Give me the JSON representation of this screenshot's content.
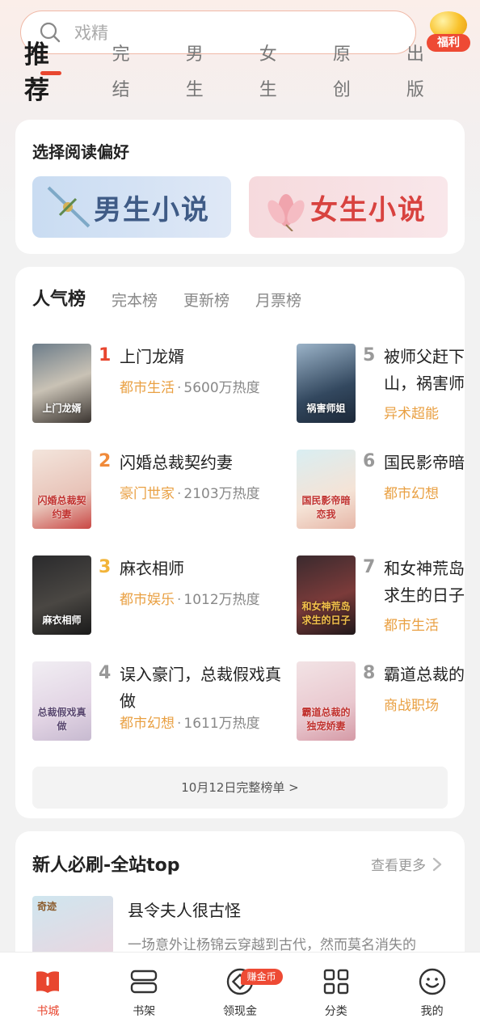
{
  "search": {
    "placeholder": "戏精"
  },
  "welfare": {
    "label": "福利"
  },
  "tabs": [
    {
      "label": "推荐",
      "active": true
    },
    {
      "label": "完结"
    },
    {
      "label": "男生"
    },
    {
      "label": "女生"
    },
    {
      "label": "原创"
    },
    {
      "label": "出版"
    }
  ],
  "preference": {
    "title": "选择阅读偏好",
    "male_label": "男生小说",
    "female_label": "女生小说"
  },
  "ranking": {
    "tabs": [
      "人气榜",
      "完本榜",
      "更新榜",
      "月票榜"
    ],
    "books": [
      {
        "rank": "1",
        "name": "上门龙婿",
        "category": "都市生活",
        "heat": "5600万热度",
        "cover_text": "上门龙婿",
        "rank_color": "#e8462f"
      },
      {
        "rank": "2",
        "name": "闪婚总裁契约妻",
        "category": "豪门世家",
        "heat": "2103万热度",
        "cover_text": "闪婚总裁契约妻",
        "rank_color": "#f08a3a"
      },
      {
        "rank": "3",
        "name": "麻衣相师",
        "category": "都市娱乐",
        "heat": "1012万热度",
        "cover_text": "麻衣相师",
        "rank_color": "#f2b43a"
      },
      {
        "rank": "4",
        "name": "误入豪门，总裁假戏真做",
        "category": "都市幻想",
        "heat": "1611万热度",
        "cover_text": "总裁假戏真做",
        "rank_color": "#999999"
      },
      {
        "rank": "5",
        "name": "被师父赶下山，祸害师姐",
        "category": "异术超能",
        "heat": "",
        "cover_text": "祸害师姐",
        "rank_color": "#999999"
      },
      {
        "rank": "6",
        "name": "国民影帝暗恋我",
        "category": "都市幻想",
        "heat": "",
        "cover_text": "国民影帝暗恋我",
        "rank_color": "#999999"
      },
      {
        "rank": "7",
        "name": "和女神荒岛求生的日子",
        "category": "都市生活",
        "heat": "",
        "cover_text": "和女神荒岛求生的日子",
        "rank_color": "#999999"
      },
      {
        "rank": "8",
        "name": "霸道总裁的独宠娇妻",
        "category": "商战职场",
        "heat": "",
        "cover_text": "霸道总裁的独宠娇妻",
        "rank_color": "#999999"
      }
    ],
    "full_list_label": "10月12日完整榜单 >"
  },
  "newbie": {
    "title": "新人必刷-全站top",
    "more_label": "查看更多",
    "book_title": "县令夫人很古怪",
    "book_desc": "一场意外让杨锦云穿越到古代，然而莫名消失的",
    "cover_text": "奇迹"
  },
  "bottom_nav": [
    {
      "label": "书城",
      "icon": "book-city-icon",
      "active": true
    },
    {
      "label": "书架",
      "icon": "bookshelf-icon"
    },
    {
      "label": "领现金",
      "icon": "cash-icon",
      "badge": "赚金币"
    },
    {
      "label": "分类",
      "icon": "category-icon"
    },
    {
      "label": "我的",
      "icon": "profile-icon"
    }
  ],
  "colors": {
    "accent": "#e8462f",
    "category": "#e9a043"
  }
}
